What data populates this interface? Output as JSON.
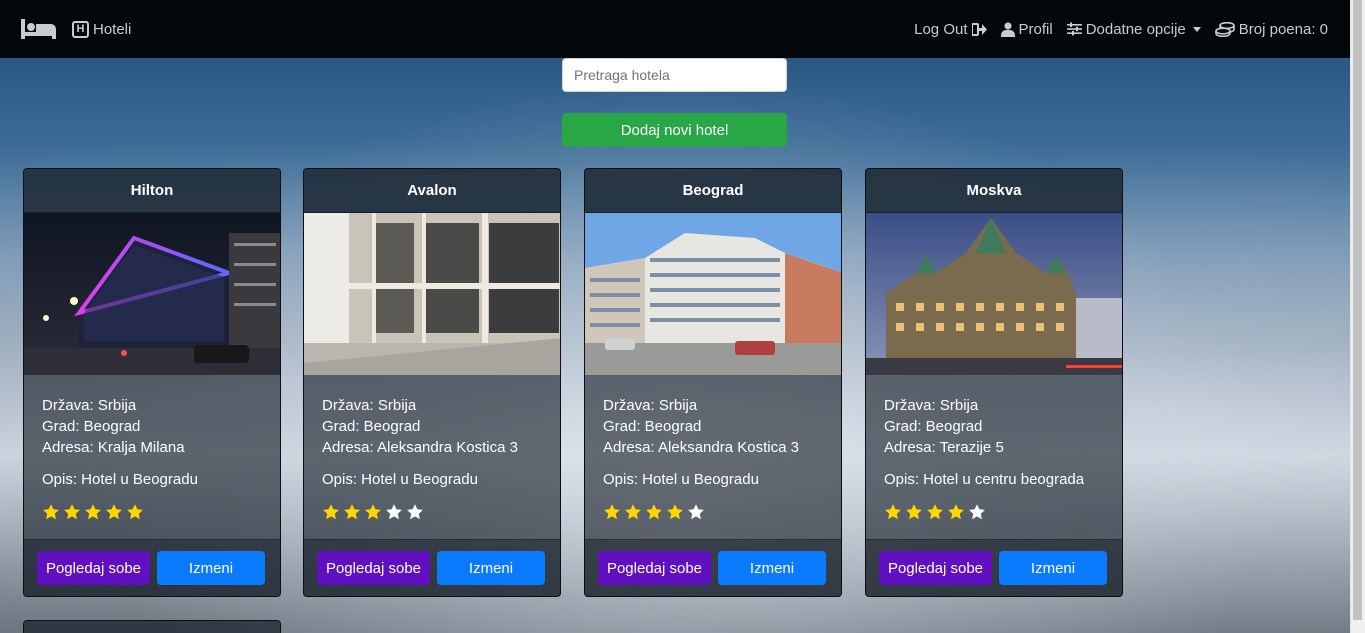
{
  "navbar": {
    "brand_icon": "bed-icon",
    "hotels_label": "Hoteli",
    "hotels_icon": "h-square-icon",
    "logout_label": "Log Out",
    "logout_icon": "sign-out-icon",
    "profile_label": "Profil",
    "profile_icon": "user-icon",
    "options_label": "Dodatne opcije",
    "options_icon": "sliders-icon",
    "points_label": "Broj poena: 0",
    "points_icon": "coins-icon"
  },
  "search": {
    "placeholder": "Pretraga hotela",
    "value": ""
  },
  "add_button": {
    "label": "Dodaj novi hotel"
  },
  "colors": {
    "navbar_bg": "#03070b",
    "success": "#28a745",
    "rooms_button": "#6010c0",
    "edit_button": "#0a7bff",
    "star_filled": "#ffd700",
    "star_empty": "#ffffff"
  },
  "hotels": [
    {
      "name": "Hilton",
      "country": "Država: Srbija",
      "city": "Grad: Beograd",
      "address": "Adresa: Kralja Milana",
      "description": "Opis: Hotel u Beogradu",
      "rating": 5,
      "max_rating": 5,
      "rooms_label": "Pogledaj sobe",
      "edit_label": "Izmeni"
    },
    {
      "name": "Avalon",
      "country": "Država: Srbija",
      "city": "Grad: Beograd",
      "address": "Adresa: Aleksandra Kostica 3",
      "description": "Opis: Hotel u Beogradu",
      "rating": 3,
      "max_rating": 5,
      "rooms_label": "Pogledaj sobe",
      "edit_label": "Izmeni"
    },
    {
      "name": "Beograd",
      "country": "Država: Srbija",
      "city": "Grad: Beograd",
      "address": "Adresa: Aleksandra Kostica 3",
      "description": "Opis: Hotel u Beogradu",
      "rating": 4,
      "max_rating": 5,
      "rooms_label": "Pogledaj sobe",
      "edit_label": "Izmeni"
    },
    {
      "name": "Moskva",
      "country": "Država: Srbija",
      "city": "Grad: Beograd",
      "address": "Adresa: Terazije 5",
      "description": "Opis: Hotel u centru beograda",
      "rating": 4,
      "max_rating": 5,
      "rooms_label": "Pogledaj sobe",
      "edit_label": "Izmeni"
    }
  ]
}
